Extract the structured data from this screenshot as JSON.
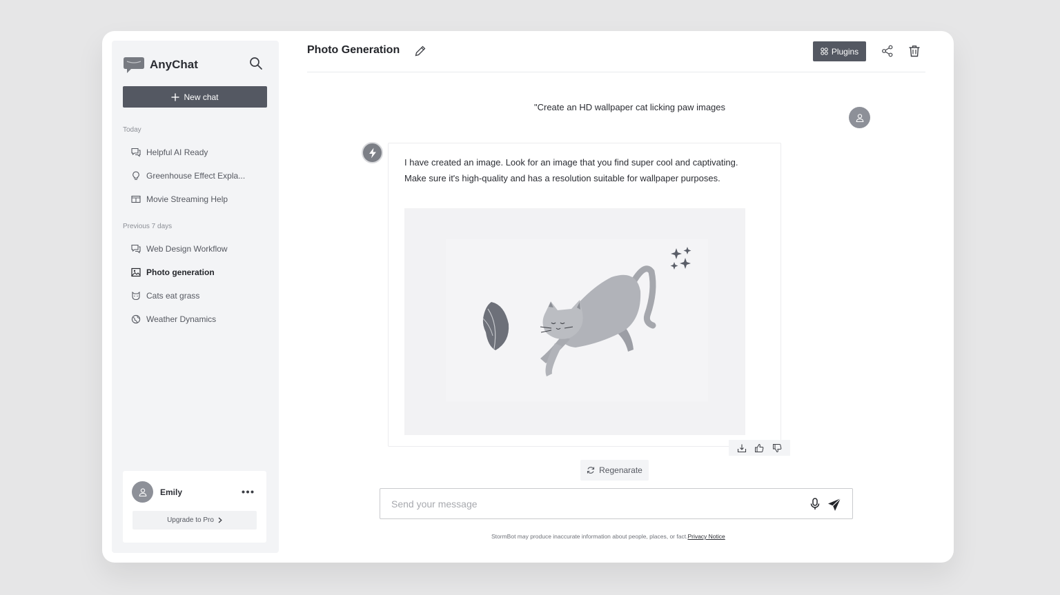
{
  "app": {
    "name": "AnyChat"
  },
  "sidebar": {
    "new_chat_label": "New chat",
    "sections": [
      {
        "label": "Today",
        "items": [
          {
            "label": "Helpful AI Ready",
            "icon": "chat-bubbles-icon",
            "active": false
          },
          {
            "label": "Greenhouse Effect Expla...",
            "icon": "lightbulb-icon",
            "active": false
          },
          {
            "label": "Movie Streaming Help",
            "icon": "film-icon",
            "active": false
          }
        ]
      },
      {
        "label": "Previous 7 days",
        "items": [
          {
            "label": "Web Design Workflow",
            "icon": "chat-bubbles-icon",
            "active": false
          },
          {
            "label": "Photo generation",
            "icon": "image-icon",
            "active": true
          },
          {
            "label": "Cats eat grass",
            "icon": "cat-icon",
            "active": false
          },
          {
            "label": "Weather Dynamics",
            "icon": "globe-icon",
            "active": false
          }
        ]
      }
    ],
    "user": {
      "name": "Emily",
      "upgrade_label": "Upgrade to Pro"
    }
  },
  "header": {
    "title": "Photo Generation",
    "plugins_label": "Plugins"
  },
  "conversation": {
    "user_message": "\"Create an HD wallpaper cat licking paw images",
    "bot_message_line1": "I have created an image. Look for an image that you find super cool and captivating.",
    "bot_message_line2": "Make sure it's high-quality and has a resolution suitable for wallpaper purposes.",
    "regenerate_label": "Regenarate"
  },
  "composer": {
    "placeholder": "Send your message"
  },
  "footer": {
    "disclaimer": "StormBot may produce inaccurate information about people, places, or fact.",
    "privacy_link": "Privacy Notice"
  },
  "colors": {
    "accent_dark": "#545862",
    "sidebar_bg": "#f3f4f6",
    "page_bg": "#e6e6e7"
  }
}
